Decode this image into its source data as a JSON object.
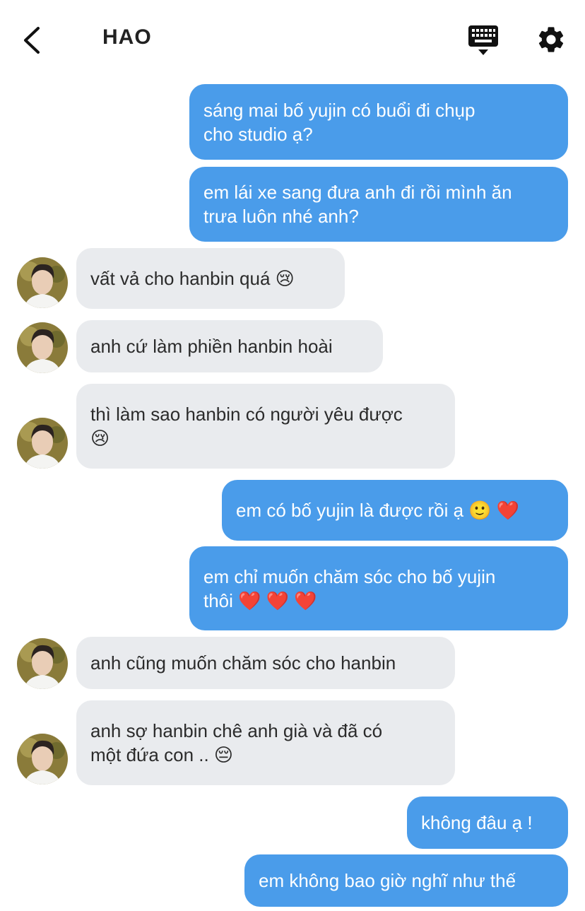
{
  "header": {
    "title": "HAO",
    "back_icon": "chevron-left-icon",
    "keyboard_icon": "keyboard-icon",
    "settings_icon": "gear-icon"
  },
  "colors": {
    "outgoing_bubble": "#4a9cea",
    "incoming_bubble": "#e9ebee",
    "title": "#222222"
  },
  "messages": [
    {
      "direction": "outgoing",
      "text": "sáng mai bố yujin có buổi đi chụp\ncho studio ạ?"
    },
    {
      "direction": "outgoing",
      "text": "em lái xe sang đưa anh đi rồi mình ăn\ntrưa luôn nhé anh?"
    },
    {
      "direction": "incoming",
      "text": "vất vả cho hanbin quá 😢"
    },
    {
      "direction": "incoming",
      "text": "anh cứ làm phiền hanbin hoài"
    },
    {
      "direction": "incoming",
      "text": "thì làm sao hanbin có người yêu được\n😢"
    },
    {
      "direction": "outgoing",
      "text": "em có bố yujin là được rồi ạ 🙂 ❤️"
    },
    {
      "direction": "outgoing",
      "text": "em chỉ muốn chăm sóc cho bố yujin\nthôi ❤️ ❤️ ❤️"
    },
    {
      "direction": "incoming",
      "text": "anh cũng muốn chăm sóc cho hanbin"
    },
    {
      "direction": "incoming",
      "text": "anh sợ hanbin chê anh già và đã có\nmột đứa con .. 😔"
    },
    {
      "direction": "outgoing",
      "text": "không đâu ạ !"
    },
    {
      "direction": "outgoing",
      "text": "em không bao giờ nghĩ như thế"
    }
  ]
}
